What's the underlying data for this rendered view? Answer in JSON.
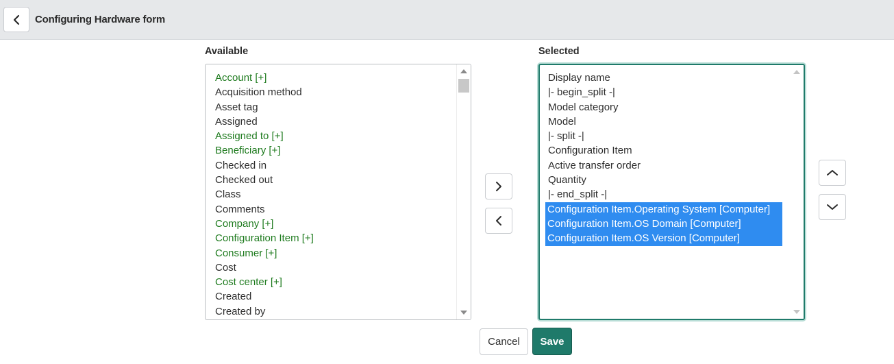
{
  "header": {
    "title": "Configuring Hardware form",
    "back_icon": "chevron-left-icon"
  },
  "available": {
    "label": "Available",
    "items": [
      {
        "label": "Account [+]",
        "ref": true
      },
      {
        "label": "Acquisition method",
        "ref": false
      },
      {
        "label": "Asset tag",
        "ref": false
      },
      {
        "label": "Assigned",
        "ref": false
      },
      {
        "label": "Assigned to [+]",
        "ref": true
      },
      {
        "label": "Beneficiary [+]",
        "ref": true
      },
      {
        "label": "Checked in",
        "ref": false
      },
      {
        "label": "Checked out",
        "ref": false
      },
      {
        "label": "Class",
        "ref": false
      },
      {
        "label": "Comments",
        "ref": false
      },
      {
        "label": "Company [+]",
        "ref": true
      },
      {
        "label": "Configuration Item [+]",
        "ref": true
      },
      {
        "label": "Consumer [+]",
        "ref": true
      },
      {
        "label": "Cost",
        "ref": false
      },
      {
        "label": "Cost center [+]",
        "ref": true
      },
      {
        "label": "Created",
        "ref": false
      },
      {
        "label": "Created by",
        "ref": false
      }
    ]
  },
  "selected": {
    "label": "Selected",
    "items": [
      {
        "label": "Display name",
        "selected": false
      },
      {
        "label": "|- begin_split -|",
        "selected": false
      },
      {
        "label": "Model category",
        "selected": false
      },
      {
        "label": "Model",
        "selected": false
      },
      {
        "label": "|- split -|",
        "selected": false
      },
      {
        "label": "Configuration Item",
        "selected": false
      },
      {
        "label": "Active transfer order",
        "selected": false
      },
      {
        "label": "Quantity",
        "selected": false
      },
      {
        "label": "|- end_split -|",
        "selected": false
      },
      {
        "label": "Configuration Item.Operating System [Computer]",
        "selected": true
      },
      {
        "label": "Configuration Item.OS Domain [Computer]",
        "selected": true
      },
      {
        "label": "Configuration Item.OS Version [Computer]",
        "selected": true
      }
    ]
  },
  "buttons": {
    "cancel": "Cancel",
    "save": "Save"
  },
  "colors": {
    "reference": "#1d7a1d",
    "selection": "#2f8cf0",
    "primary": "#1f7a6a"
  }
}
